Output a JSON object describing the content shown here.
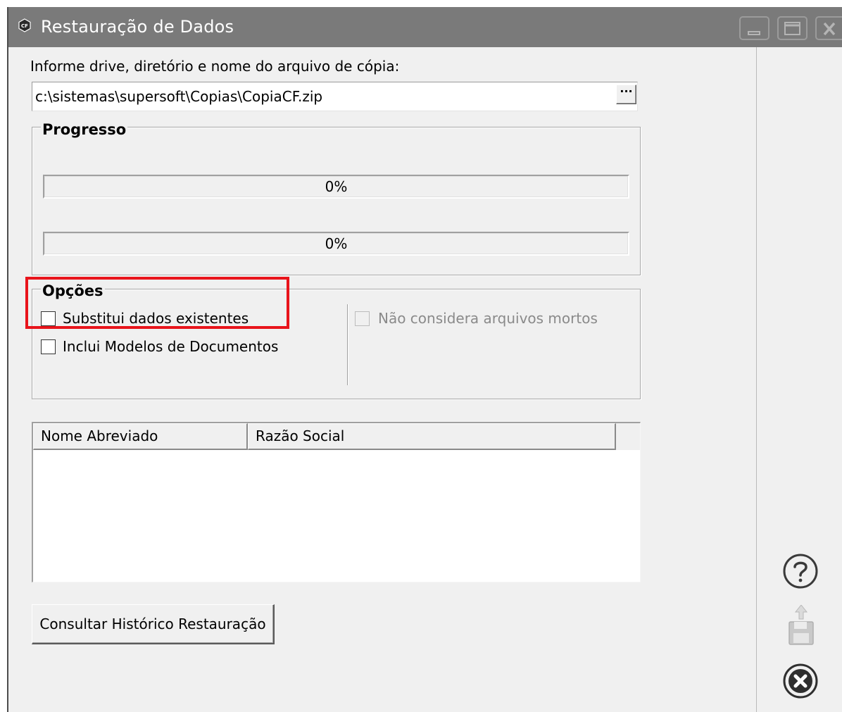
{
  "window": {
    "title": "Restauração de Dados",
    "app_icon_text": "CF",
    "controls": {
      "minimize": "minimize-icon",
      "maximize": "maximize-icon",
      "close": "close-icon"
    }
  },
  "file": {
    "label": "Informe drive, diretório e nome do arquivo de cópia:",
    "path": "c:\\sistemas\\supersoft\\Copias\\CopiaCF.zip",
    "browse_label": "···"
  },
  "progress": {
    "title": "Progresso",
    "bars": [
      {
        "percent": 0,
        "text": "0%"
      },
      {
        "percent": 0,
        "text": "0%"
      }
    ]
  },
  "options": {
    "title": "Opções",
    "substitui": {
      "label": "Substitui dados existentes",
      "checked": false
    },
    "inclui_modelos": {
      "label": "Inclui Modelos de Documentos",
      "checked": false
    },
    "nao_considera": {
      "label": "Não considera arquivos mortos",
      "checked": false,
      "enabled": false
    }
  },
  "table": {
    "columns": [
      "Nome Abreviado",
      "Razão Social"
    ],
    "rows": []
  },
  "buttons": {
    "historico": "Consultar Histórico Restauração"
  },
  "sidebar": {
    "icons": [
      "help-icon",
      "export-disk-icon",
      "close-circle-icon"
    ]
  },
  "colors": {
    "titlebar": "#7a7a7a",
    "highlight": "#e8141b",
    "background": "#f0f0f0"
  }
}
